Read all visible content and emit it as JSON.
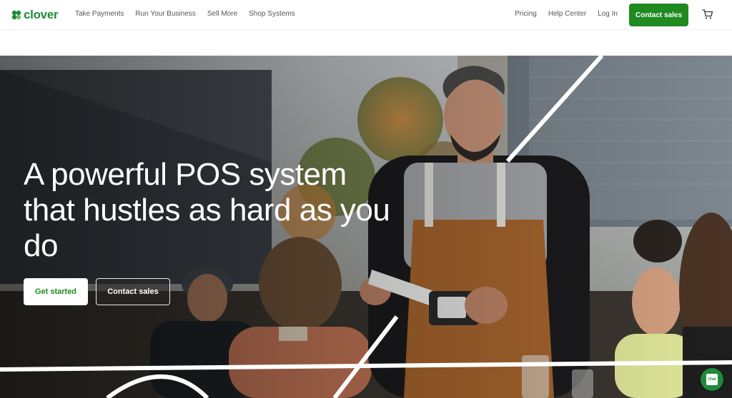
{
  "header": {
    "logo_text": "clover",
    "nav_left": [
      {
        "label": "Take Payments"
      },
      {
        "label": "Run Your Business"
      },
      {
        "label": "Sell More"
      },
      {
        "label": "Shop Systems"
      }
    ],
    "nav_right": [
      {
        "label": "Pricing"
      },
      {
        "label": "Help Center"
      },
      {
        "label": "Log In"
      }
    ],
    "contact_label": "Contact sales",
    "cart_icon": "cart-icon"
  },
  "hero": {
    "headline": "A powerful POS system that hustles as hard as you do",
    "primary_cta": "Get started",
    "secondary_cta": "Contact sales"
  },
  "chat": {
    "icon": "chat-icon",
    "label": "Chat"
  },
  "colors": {
    "brand_green": "#1f8a3a",
    "button_green": "#1f8a1f",
    "nav_text": "#555555"
  }
}
